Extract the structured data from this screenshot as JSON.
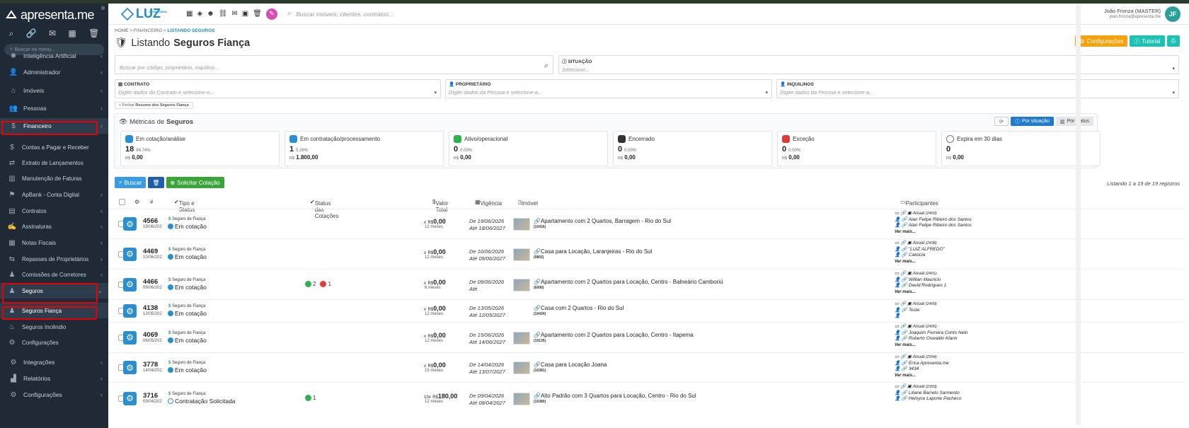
{
  "sidebar": {
    "brand": "apresenta.me",
    "search_placeholder": "Buscar no menu...",
    "items": [
      {
        "label": "Inteligência Artificial",
        "icon": "ai-icon",
        "chev": "‹"
      },
      {
        "label": "Administrador",
        "icon": "user-icon",
        "chev": "‹"
      },
      {
        "label": "Imóveis",
        "icon": "home-icon",
        "chev": "‹"
      },
      {
        "label": "Pessoas",
        "icon": "people-icon",
        "chev": "‹"
      },
      {
        "label": "Financeiro",
        "icon": "money-icon",
        "chev": "‹"
      },
      {
        "label": "Contas a Pagar e Receber",
        "icon": "dollar-icon"
      },
      {
        "label": "Extrato de Lançamentos",
        "icon": "shuffle-icon"
      },
      {
        "label": "Manutenção de Faturas",
        "icon": "barcode-icon"
      },
      {
        "label": "ApBank - Conta Digital",
        "icon": "bank-icon",
        "chev": "‹"
      },
      {
        "label": "Contratos",
        "icon": "contract-icon",
        "chev": "‹"
      },
      {
        "label": "Assinaturas",
        "icon": "signature-icon",
        "chev": "‹"
      },
      {
        "label": "Notas Fiscais",
        "icon": "invoice-icon",
        "chev": "‹"
      },
      {
        "label": "Repasses de Proprietários",
        "icon": "transfer-icon",
        "chev": "‹"
      },
      {
        "label": "Comissões de Corretores",
        "icon": "commission-icon",
        "chev": "‹"
      },
      {
        "label": "Seguros",
        "icon": "insurance-icon",
        "chev": "⌄"
      },
      {
        "label": "Seguros Fiança",
        "icon": "insurance-icon"
      },
      {
        "label": "Seguros Incêndio",
        "icon": "fire-icon"
      },
      {
        "label": "Configurações",
        "icon": "gear-icon"
      },
      {
        "label": "Integrações",
        "icon": "integration-icon",
        "chev": "‹"
      },
      {
        "label": "Relatórios",
        "icon": "report-icon",
        "chev": "‹"
      },
      {
        "label": "Configurações",
        "icon": "gear-icon",
        "chev": "‹"
      }
    ]
  },
  "topbar": {
    "logo": "LUZ",
    "logo_small": "IMOBILIÁRIA",
    "search_placeholder": "Buscar imóveis, clientes, contratos...",
    "user_name": "João Fronza (MASTER)",
    "user_email": "joao.fronza@apresenta.me",
    "avatar": "JF"
  },
  "breadcrumb": {
    "home": "HOME",
    "sep": ">",
    "financeiro": "FINANCEIRO",
    "current": "LISTANDO SEGUROS"
  },
  "page_title": {
    "prefix": "Listando",
    "bold": "Seguros Fiança"
  },
  "top_buttons": {
    "config": "Configurações",
    "tutorial": "Tutorial"
  },
  "filters": {
    "search_placeholder": "Buscar por código, proprietário, inquilino...",
    "situacao_label": "SITUAÇÃO",
    "situacao_placeholder": "Selecione...",
    "contrato_label": "CONTRATO",
    "contrato_placeholder": "Digite dados do Contrato e selecione-o...",
    "proprietario_label": "PROPRIETÁRIO",
    "proprietario_placeholder": "Digite dados da Pessoa e selecione-a...",
    "inquilinos_label": "INQUILINOS",
    "inquilinos_placeholder": "Digite dados da Pessoa e selecione-a...",
    "fechar_prefix": "Fechar",
    "fechar_bold": "Resumo dos Seguros Fiança"
  },
  "metrics": {
    "title_prefix": "Métricas de",
    "title_bold": "Seguros",
    "btn_situacao": "Por situação",
    "btn_status": "Por status",
    "cards": [
      {
        "title": "Em cotação/análise",
        "count": "18",
        "pct": "94.74%",
        "rs": "R$",
        "amount": "0,00",
        "color": "#2a8fd0"
      },
      {
        "title": "Em contratação/processamento",
        "count": "1",
        "pct": "5.26%",
        "rs": "R$",
        "amount": "1.800,00",
        "color": "#2a8fd0"
      },
      {
        "title": "Ativo/operacional",
        "count": "0",
        "pct": "0.00%",
        "rs": "R$",
        "amount": "0,00",
        "color": "#2cb34a"
      },
      {
        "title": "Encerrado",
        "count": "0",
        "pct": "0.00%",
        "rs": "R$",
        "amount": "0,00",
        "color": "#333333"
      },
      {
        "title": "Exceção",
        "count": "0",
        "pct": "0.00%",
        "rs": "R$",
        "amount": "0,00",
        "color": "#e03a3a"
      },
      {
        "title": "Expira em 30 dias",
        "count": "0",
        "pct": "",
        "rs": "R$",
        "amount": "0,00",
        "color": "#ffffff"
      }
    ]
  },
  "actions": {
    "buscar": "Buscar",
    "solicitar": "Solicitar Cotação",
    "listing": "Listando 1 a 19 de 19 registros"
  },
  "table": {
    "headers": {
      "tipo": "Tipo e Status",
      "status_cot": "Status das Cotações",
      "valor": "Valor Total",
      "vigencia": "Vigência",
      "imovel": "Imóvel",
      "participantes": "Participantes"
    },
    "rows": [
      {
        "num": "4566",
        "date": "19/06/202",
        "tipo": "Seguro de Fiança",
        "status": "Em cotação",
        "mult": "x",
        "rs": "R$",
        "valor": "0,00",
        "meses": "12 meses",
        "de": "De 19/06/2026",
        "ate": "Até 18/06/2027",
        "imovel": "Apartamento com 2 Quartos, Barragem - Rio do Sul",
        "cod": "(10416)",
        "p1": "Anual",
        "p1c": "(2450)",
        "p2": "Alan Felipe Ribeiro dos Santos",
        "p3": "Alan Felipe Ribeiro dos Santos",
        "vermais": "Ver mais...",
        "thumb": true,
        "badges": []
      },
      {
        "num": "4469",
        "date": "10/06/202",
        "tipo": "Seguro de Fiança",
        "status": "Em cotação",
        "mult": "x",
        "rs": "R$",
        "valor": "0,00",
        "meses": "12 meses",
        "de": "De 10/06/2026",
        "ate": "Até 09/06/2027",
        "imovel": "Casa para Locação, Laranjeiras - Rio do Sul",
        "cod": "(9802)",
        "p1": "Anual",
        "p1c": "(2438)",
        "p2": "\"LUIZ ALFREDO\"",
        "p3": "Catiúcia",
        "vermais": "Ver mais...",
        "thumb": true,
        "badges": []
      },
      {
        "num": "4466",
        "date": "09/06/202",
        "tipo": "Seguro de Fiança",
        "status": "Em cotação",
        "mult": "x",
        "rs": "R$",
        "valor": "0,00",
        "meses": "6 meses",
        "de": "De 09/06/2026",
        "ate": "Até",
        "imovel": "Apartamento com 2 Quartos para Locação, Centro - Balneário Camboriú",
        "cod": "(6090)",
        "p1": "Anual",
        "p1c": "(2401)",
        "p2": "Willian Mauricio",
        "p3": "David Rodrigues 1",
        "vermais": "Ver mais...",
        "thumb": true,
        "badges": [
          {
            "n": "2",
            "c": "#2cb34a"
          },
          {
            "n": "1",
            "c": "#e03a3a"
          }
        ]
      },
      {
        "num": "4138",
        "date": "13/05/202",
        "tipo": "Seguro de Fiança",
        "status": "Em cotação",
        "mult": "x",
        "rs": "R$",
        "valor": "0,00",
        "meses": "12 meses",
        "de": "De 13/05/2026",
        "ate": "Até 12/05/2027",
        "imovel": "Casa com 2 Quartos - Rio do Sul",
        "cod": "(10424)",
        "p1": "Anual",
        "p1c": "(2409)",
        "p2": "Teste",
        "p3": "",
        "vermais": "",
        "thumb": false,
        "badges": []
      },
      {
        "num": "4069",
        "date": "06/05/202",
        "tipo": "Seguro de Fiança",
        "status": "Em cotação",
        "mult": "x",
        "rs": "R$",
        "valor": "0,00",
        "meses": "12 meses",
        "de": "De 15/06/2026",
        "ate": "Até 14/06/2027",
        "imovel": "Apartamento com 2 Quartos para Locação, Centro - Itapema",
        "cod": "(10135)",
        "p1": "Anual",
        "p1c": "(2405)",
        "p2": "Joaquim Ferreira Conto Neto",
        "p3": "Roberto Oswaldo Klann",
        "vermais": "Ver mais...",
        "thumb": true,
        "badges": []
      },
      {
        "num": "3778",
        "date": "14/04/202",
        "tipo": "Seguro de Fiança",
        "status": "Em cotação",
        "mult": "x",
        "rs": "R$",
        "valor": "0,00",
        "meses": "15 meses",
        "de": "De 14/04/2026",
        "ate": "Até 13/07/2027",
        "imovel": "Casa para Locação Joana",
        "cod": "(10381)",
        "p1": "Anual",
        "p1c": "(2394)",
        "p2": "Erica Apresenta.me",
        "p3": "3434",
        "vermais": "Ver mais...",
        "thumb": true,
        "badges": []
      },
      {
        "num": "3716",
        "date": "09/04/202",
        "tipo": "Seguro de Fiança",
        "status": "Contratação Solicitada",
        "mult": "10x",
        "rs": "R$",
        "valor": "180,00",
        "meses": "12 meses",
        "de": "De 09/04/2026",
        "ate": "Até 08/04/2027",
        "imovel": "Alto Padrão com 3 Quartos para Locação, Centro - Rio do Sul",
        "cod": "(10380)",
        "p1": "Anual",
        "p1c": "(2393)",
        "p2": "Liliane Barreto Sarmento",
        "p3": "Heloyce Laporte Pacheco",
        "vermais": "",
        "thumb": true,
        "badges": [
          {
            "n": "1",
            "c": "#2cb34a"
          }
        ]
      }
    ]
  }
}
